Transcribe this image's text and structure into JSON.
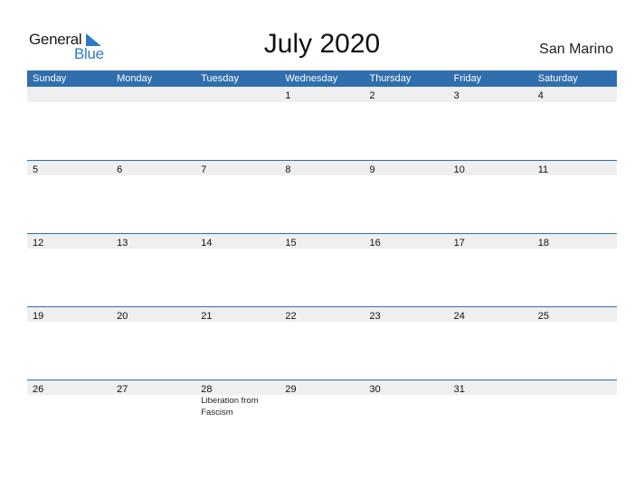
{
  "logo": {
    "general": "General",
    "blue": "Blue"
  },
  "title": "July 2020",
  "country": "San Marino",
  "colors": {
    "accent": "#2f6fae",
    "strip": "#efefef",
    "logo_blue": "#2d7bc4"
  },
  "weekdays": [
    "Sunday",
    "Monday",
    "Tuesday",
    "Wednesday",
    "Thursday",
    "Friday",
    "Saturday"
  ],
  "weeks": [
    [
      "",
      "",
      "",
      "1",
      "2",
      "3",
      "4"
    ],
    [
      "5",
      "6",
      "7",
      "8",
      "9",
      "10",
      "11"
    ],
    [
      "12",
      "13",
      "14",
      "15",
      "16",
      "17",
      "18"
    ],
    [
      "19",
      "20",
      "21",
      "22",
      "23",
      "24",
      "25"
    ],
    [
      "26",
      "27",
      "28",
      "29",
      "30",
      "31",
      ""
    ]
  ],
  "events": {
    "4-2": "Liberation from Fascism"
  }
}
